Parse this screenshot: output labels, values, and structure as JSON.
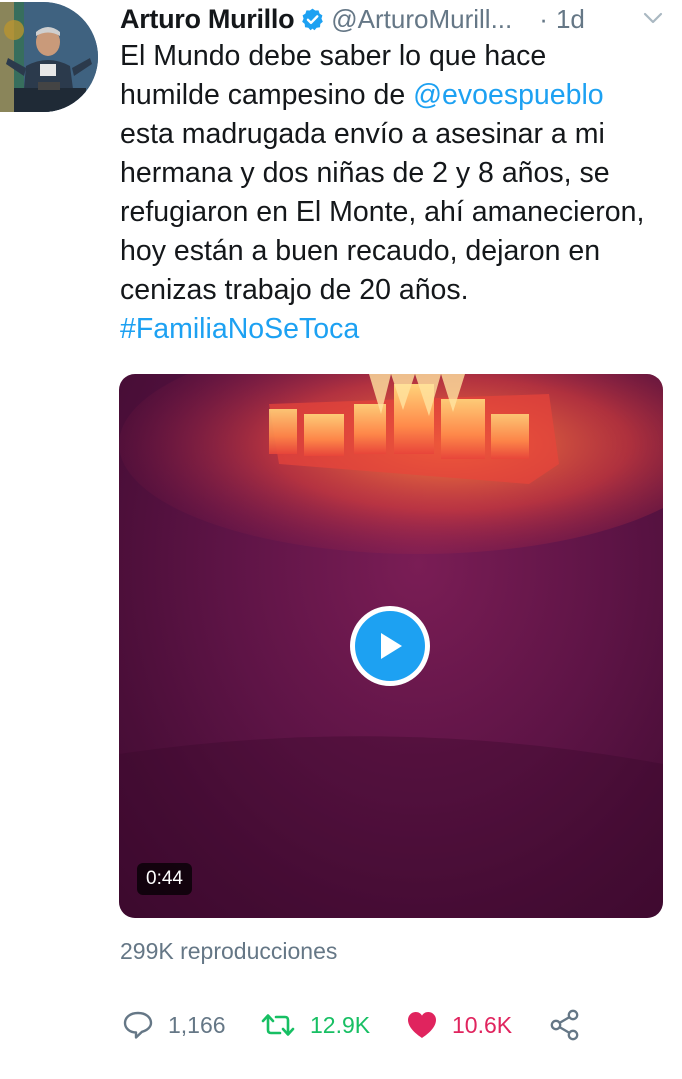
{
  "tweet": {
    "author_name": "Arturo Murillo",
    "handle": "@ArturoMurill...",
    "separator": "·",
    "time": "1d",
    "verified_icon": "verified-badge-icon",
    "text_lines": {
      "l1": "El Mundo debe saber lo que hace",
      "l2": "humilde campesino de ",
      "l2_mention": "@evoespueblo",
      "l3": "esta madrugada envío a asesinar a mi",
      "l4": "hermana y dos niñas de 2 y 8 años, se",
      "l5": "refugiaron en El Monte, ahí amanecieron,",
      "l6": "hoy están a buen recaudo, dejaron en",
      "l7": "cenizas trabajo de 20 años.",
      "hashtag": "#FamiliaNoSeToca"
    }
  },
  "video": {
    "duration": "0:44",
    "play_icon": "play-icon",
    "views": "299K reproducciones"
  },
  "actions": {
    "reply_count": "1,166",
    "retweet_count": "12.9K",
    "like_count": "10.6K"
  },
  "colors": {
    "link": "#1da1f2",
    "retweet": "#17bf63",
    "like": "#e0245e",
    "muted": "#657786"
  }
}
